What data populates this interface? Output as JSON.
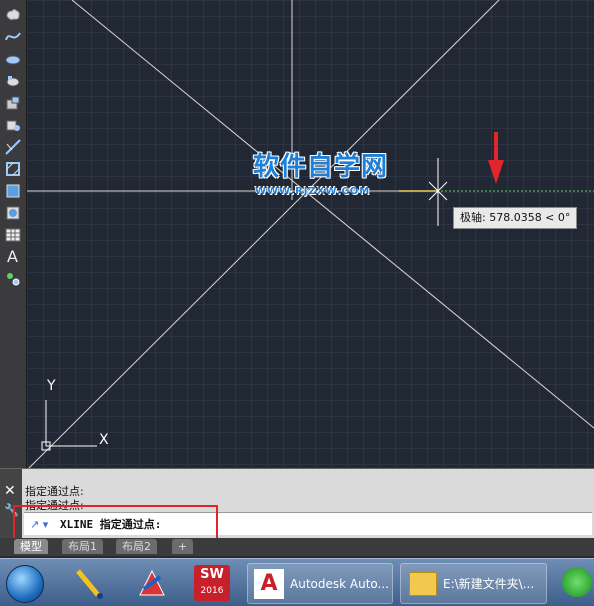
{
  "toolbar": {
    "tools": [
      "revision-cloud-icon",
      "spline-icon",
      "ellipse-icon",
      "ellipse-arc-icon",
      "insert-block-icon",
      "make-block-icon",
      "point-icon",
      "hatch-icon",
      "gradient-icon",
      "region-icon",
      "table-icon",
      "multiline-text-label",
      "add-selected-icon"
    ],
    "text_tool_label": "A"
  },
  "canvas": {
    "watermark_title": "软件自学网",
    "watermark_url": "WWW.RJZXW.COM",
    "tooltip": "极轴: 578.0358 < 0°",
    "ucs_x_label": "X",
    "ucs_y_label": "Y",
    "colors": {
      "background": "#212834",
      "lines": "#ffffff",
      "arrow": "#e0262d",
      "polar_track": "#5fd35f"
    }
  },
  "command": {
    "history": [
      "指定通过点:",
      "指定通过点:"
    ],
    "input_prompt": "XLINE 指定通过点:"
  },
  "tabs": {
    "items": [
      "模型",
      "布局1",
      "布局2"
    ],
    "add_label": "+"
  },
  "taskbar": {
    "apps": [
      {
        "icon": "autocad-icon",
        "label": "Autodesk Auto..."
      },
      {
        "icon": "folder-icon",
        "label": "E:\\新建文件夹\\..."
      }
    ],
    "sw_badge": "2016"
  }
}
